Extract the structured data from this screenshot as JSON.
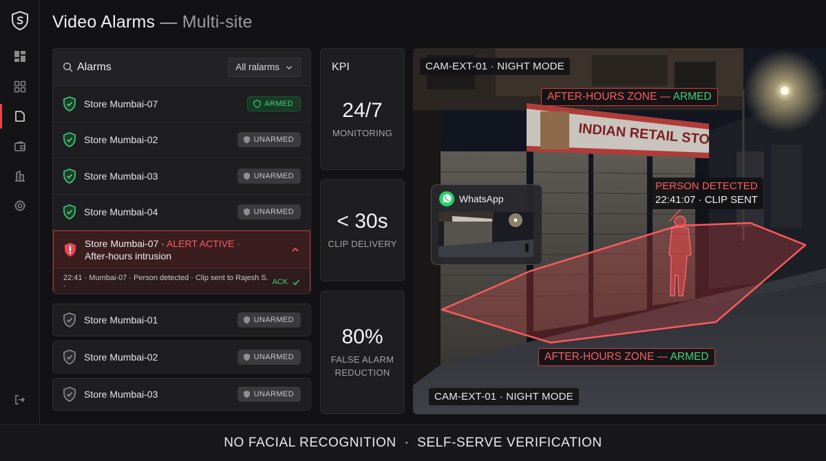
{
  "header": {
    "title": "Video Alarms",
    "separator": "—",
    "subtitle": "Multi-site"
  },
  "sidebar": {
    "items": [
      {
        "icon": "dashboard-icon"
      },
      {
        "icon": "grid-icon"
      },
      {
        "icon": "document-icon",
        "active": true
      },
      {
        "icon": "wallet-icon"
      },
      {
        "icon": "building-icon"
      },
      {
        "icon": "gear-icon"
      }
    ],
    "logout_icon": "logout-icon"
  },
  "alarms": {
    "title": "Alarms",
    "filter": "All ralarms",
    "rows": [
      {
        "name": "Store Mumbai-07",
        "status": "ARMED"
      },
      {
        "name": "Store Mumbai-02",
        "status": "UNARMED"
      },
      {
        "name": "Store Mumbai-03",
        "status": "UNARMED"
      },
      {
        "name": "Store Mumbai-04",
        "status": "UNARMED"
      }
    ],
    "alert": {
      "store": "Store Mumbai-07 ·",
      "state": "ALERT ACTIVE ·",
      "description": "After-hours intrusion",
      "log": "22:41 · Mumbai-07 · Person detected · Clip sent to Rajesh S. ·",
      "ack": "ACK"
    },
    "cards": [
      {
        "name": "Store Mumbai-01",
        "status": "UNARMED"
      },
      {
        "name": "Store Mumbai-02",
        "status": "UNARMED"
      },
      {
        "name": "Store Mumbai-03",
        "status": "UNARMED"
      }
    ]
  },
  "kpi": {
    "label": "KPI",
    "items": [
      {
        "value": "24/7",
        "label": "MONITORING"
      },
      {
        "value": "< 30s",
        "label": "CLIP DELIVERY"
      },
      {
        "value": "80%",
        "label_line1": "FALSE ALARM",
        "label_line2": "REDUCTION"
      }
    ]
  },
  "camera": {
    "tag_top": "CAM-EXT-01 · NIGHT MODE",
    "tag_bottom": "CAM-EXT-01 · NIGHT MODE",
    "zone_label": "AFTER-HOURS ZONE —",
    "zone_state": "ARMED",
    "detection_title": "PERSON DETECTED",
    "detection_detail": "22:41:07 · CLIP SENT",
    "store_sign": "INDIAN RETAIL STORE",
    "whatsapp_label": "WhatsApp"
  },
  "footer": {
    "text": "NO FACIAL RECOGNITION  ·  SELF-SERVE VERIFICATION"
  },
  "colors": {
    "accent_red": "#e5484d",
    "armed_green": "#45d07b",
    "background": "#121214"
  }
}
